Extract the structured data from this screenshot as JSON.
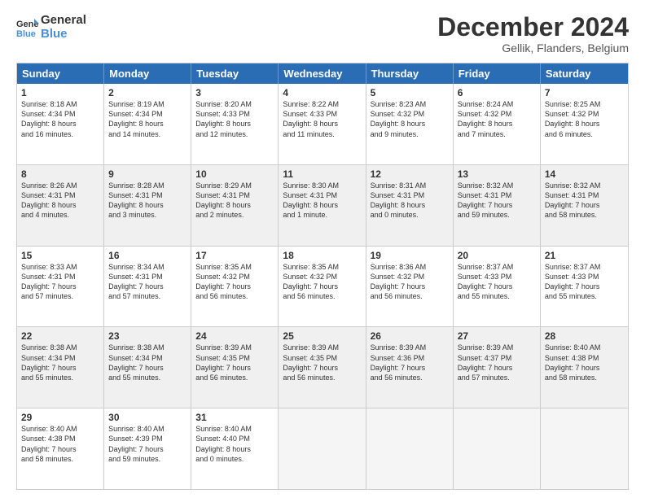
{
  "header": {
    "logo_line1": "General",
    "logo_line2": "Blue",
    "month": "December 2024",
    "location": "Gellik, Flanders, Belgium"
  },
  "days_of_week": [
    "Sunday",
    "Monday",
    "Tuesday",
    "Wednesday",
    "Thursday",
    "Friday",
    "Saturday"
  ],
  "weeks": [
    [
      {
        "day": "1",
        "text": "Sunrise: 8:18 AM\nSunset: 4:34 PM\nDaylight: 8 hours\nand 16 minutes.",
        "shaded": false
      },
      {
        "day": "2",
        "text": "Sunrise: 8:19 AM\nSunset: 4:34 PM\nDaylight: 8 hours\nand 14 minutes.",
        "shaded": false
      },
      {
        "day": "3",
        "text": "Sunrise: 8:20 AM\nSunset: 4:33 PM\nDaylight: 8 hours\nand 12 minutes.",
        "shaded": false
      },
      {
        "day": "4",
        "text": "Sunrise: 8:22 AM\nSunset: 4:33 PM\nDaylight: 8 hours\nand 11 minutes.",
        "shaded": false
      },
      {
        "day": "5",
        "text": "Sunrise: 8:23 AM\nSunset: 4:32 PM\nDaylight: 8 hours\nand 9 minutes.",
        "shaded": false
      },
      {
        "day": "6",
        "text": "Sunrise: 8:24 AM\nSunset: 4:32 PM\nDaylight: 8 hours\nand 7 minutes.",
        "shaded": false
      },
      {
        "day": "7",
        "text": "Sunrise: 8:25 AM\nSunset: 4:32 PM\nDaylight: 8 hours\nand 6 minutes.",
        "shaded": false
      }
    ],
    [
      {
        "day": "8",
        "text": "Sunrise: 8:26 AM\nSunset: 4:31 PM\nDaylight: 8 hours\nand 4 minutes.",
        "shaded": true
      },
      {
        "day": "9",
        "text": "Sunrise: 8:28 AM\nSunset: 4:31 PM\nDaylight: 8 hours\nand 3 minutes.",
        "shaded": true
      },
      {
        "day": "10",
        "text": "Sunrise: 8:29 AM\nSunset: 4:31 PM\nDaylight: 8 hours\nand 2 minutes.",
        "shaded": true
      },
      {
        "day": "11",
        "text": "Sunrise: 8:30 AM\nSunset: 4:31 PM\nDaylight: 8 hours\nand 1 minute.",
        "shaded": true
      },
      {
        "day": "12",
        "text": "Sunrise: 8:31 AM\nSunset: 4:31 PM\nDaylight: 8 hours\nand 0 minutes.",
        "shaded": true
      },
      {
        "day": "13",
        "text": "Sunrise: 8:32 AM\nSunset: 4:31 PM\nDaylight: 7 hours\nand 59 minutes.",
        "shaded": true
      },
      {
        "day": "14",
        "text": "Sunrise: 8:32 AM\nSunset: 4:31 PM\nDaylight: 7 hours\nand 58 minutes.",
        "shaded": true
      }
    ],
    [
      {
        "day": "15",
        "text": "Sunrise: 8:33 AM\nSunset: 4:31 PM\nDaylight: 7 hours\nand 57 minutes.",
        "shaded": false
      },
      {
        "day": "16",
        "text": "Sunrise: 8:34 AM\nSunset: 4:31 PM\nDaylight: 7 hours\nand 57 minutes.",
        "shaded": false
      },
      {
        "day": "17",
        "text": "Sunrise: 8:35 AM\nSunset: 4:32 PM\nDaylight: 7 hours\nand 56 minutes.",
        "shaded": false
      },
      {
        "day": "18",
        "text": "Sunrise: 8:35 AM\nSunset: 4:32 PM\nDaylight: 7 hours\nand 56 minutes.",
        "shaded": false
      },
      {
        "day": "19",
        "text": "Sunrise: 8:36 AM\nSunset: 4:32 PM\nDaylight: 7 hours\nand 56 minutes.",
        "shaded": false
      },
      {
        "day": "20",
        "text": "Sunrise: 8:37 AM\nSunset: 4:33 PM\nDaylight: 7 hours\nand 55 minutes.",
        "shaded": false
      },
      {
        "day": "21",
        "text": "Sunrise: 8:37 AM\nSunset: 4:33 PM\nDaylight: 7 hours\nand 55 minutes.",
        "shaded": false
      }
    ],
    [
      {
        "day": "22",
        "text": "Sunrise: 8:38 AM\nSunset: 4:34 PM\nDaylight: 7 hours\nand 55 minutes.",
        "shaded": true
      },
      {
        "day": "23",
        "text": "Sunrise: 8:38 AM\nSunset: 4:34 PM\nDaylight: 7 hours\nand 55 minutes.",
        "shaded": true
      },
      {
        "day": "24",
        "text": "Sunrise: 8:39 AM\nSunset: 4:35 PM\nDaylight: 7 hours\nand 56 minutes.",
        "shaded": true
      },
      {
        "day": "25",
        "text": "Sunrise: 8:39 AM\nSunset: 4:35 PM\nDaylight: 7 hours\nand 56 minutes.",
        "shaded": true
      },
      {
        "day": "26",
        "text": "Sunrise: 8:39 AM\nSunset: 4:36 PM\nDaylight: 7 hours\nand 56 minutes.",
        "shaded": true
      },
      {
        "day": "27",
        "text": "Sunrise: 8:39 AM\nSunset: 4:37 PM\nDaylight: 7 hours\nand 57 minutes.",
        "shaded": true
      },
      {
        "day": "28",
        "text": "Sunrise: 8:40 AM\nSunset: 4:38 PM\nDaylight: 7 hours\nand 58 minutes.",
        "shaded": true
      }
    ],
    [
      {
        "day": "29",
        "text": "Sunrise: 8:40 AM\nSunset: 4:38 PM\nDaylight: 7 hours\nand 58 minutes.",
        "shaded": false
      },
      {
        "day": "30",
        "text": "Sunrise: 8:40 AM\nSunset: 4:39 PM\nDaylight: 7 hours\nand 59 minutes.",
        "shaded": false
      },
      {
        "day": "31",
        "text": "Sunrise: 8:40 AM\nSunset: 4:40 PM\nDaylight: 8 hours\nand 0 minutes.",
        "shaded": false
      },
      {
        "day": "",
        "text": "",
        "shaded": false,
        "empty": true
      },
      {
        "day": "",
        "text": "",
        "shaded": false,
        "empty": true
      },
      {
        "day": "",
        "text": "",
        "shaded": false,
        "empty": true
      },
      {
        "day": "",
        "text": "",
        "shaded": false,
        "empty": true
      }
    ]
  ]
}
